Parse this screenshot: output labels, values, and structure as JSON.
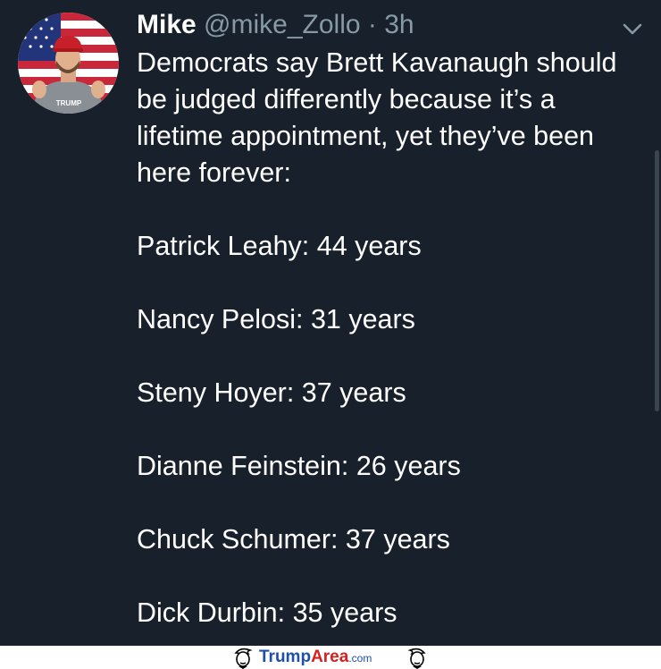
{
  "tweet": {
    "display_name": "Mike",
    "handle": "@mike_Zollo",
    "separator": "·",
    "time": "3h",
    "avatar_cap_text": "TRUMP",
    "lines": [
      "Democrats say Brett Kavanaugh should be judged differently because it’s a lifetime appointment, yet they’ve been here forever:",
      "Patrick Leahy: 44 years",
      "Nancy Pelosi: 31 years",
      "Steny Hoyer: 37 years",
      "Dianne Feinstein: 26 years",
      "Chuck Schumer: 37 years",
      "Dick Durbin: 35 years"
    ]
  },
  "footer": {
    "brand_part1": "Trump",
    "brand_part2": "Area",
    "brand_part3": ".com"
  },
  "colors": {
    "background": "#18212b",
    "text": "#ffffff",
    "muted": "#8899a6",
    "brand_blue": "#1f4fa8",
    "brand_red": "#d42020"
  },
  "icons": [
    "profile-avatar",
    "chevron-down-icon",
    "trump-caricature-icon"
  ]
}
